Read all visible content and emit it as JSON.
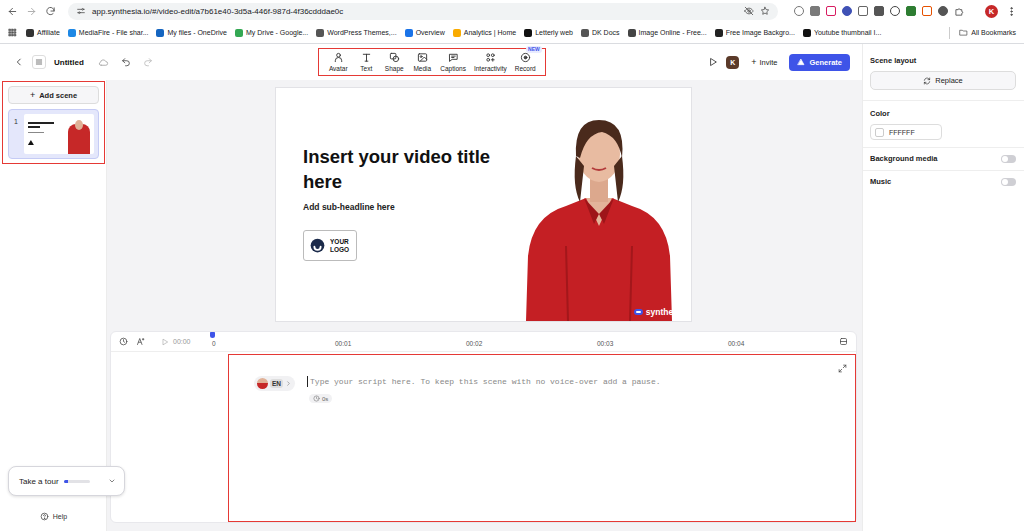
{
  "browser": {
    "url": "app.synthesia.io/#/video-edit/a7b61e40-3d5a-446f-987d-4f36cdddae0c",
    "profile": "K",
    "bookmarks": [
      "Affiliate",
      "MediaFire - File shar...",
      "My files - OneDrive",
      "My Drive - Google...",
      "WordPress Themes,...",
      "Overview",
      "Analytics | Home",
      "Letterly web",
      "DK Docs",
      "Image Online - Free...",
      "Free Image Backgro...",
      "Youtube thumbnail I..."
    ],
    "all_bookmarks": "All Bookmarks"
  },
  "toolbar": {
    "title": "Untitled",
    "highlighted": true,
    "tools": [
      {
        "label": "Avatar"
      },
      {
        "label": "Text"
      },
      {
        "label": "Shape"
      },
      {
        "label": "Media"
      },
      {
        "label": "Captions"
      },
      {
        "label": "Interactivity"
      },
      {
        "label": "Record",
        "badge": "NEW"
      }
    ],
    "profile": "K",
    "invite_icon": "+",
    "invite": "Invite",
    "generate": "Generate"
  },
  "scenes": {
    "highlighted": true,
    "add_icon": "+",
    "add": "Add scene",
    "items": [
      {
        "number": "1",
        "selected": true
      }
    ]
  },
  "canvas": {
    "title": "Insert your video title here",
    "subtitle": "Add sub-headline here",
    "logo": [
      "YOUR",
      "LOGO"
    ],
    "watermark": "synthesia"
  },
  "timeline": {
    "time": "00:00",
    "ticks": [
      "0",
      "00:01",
      "00:02",
      "00:03",
      "00:04"
    ]
  },
  "script": {
    "highlighted": true,
    "language": "EN",
    "placeholder": "Type your script here. To keep this scene with no voice-over add a pause.",
    "duration": "0s"
  },
  "tour": {
    "label": "Take a tour",
    "level": 0.18
  },
  "help": "Help",
  "properties": {
    "heading": "Scene layout",
    "replace": "Replace",
    "color_label": "Color",
    "color_value": "FFFFFF",
    "toggles": [
      {
        "label": "Background media",
        "on": false
      },
      {
        "label": "Music",
        "on": false
      }
    ]
  }
}
